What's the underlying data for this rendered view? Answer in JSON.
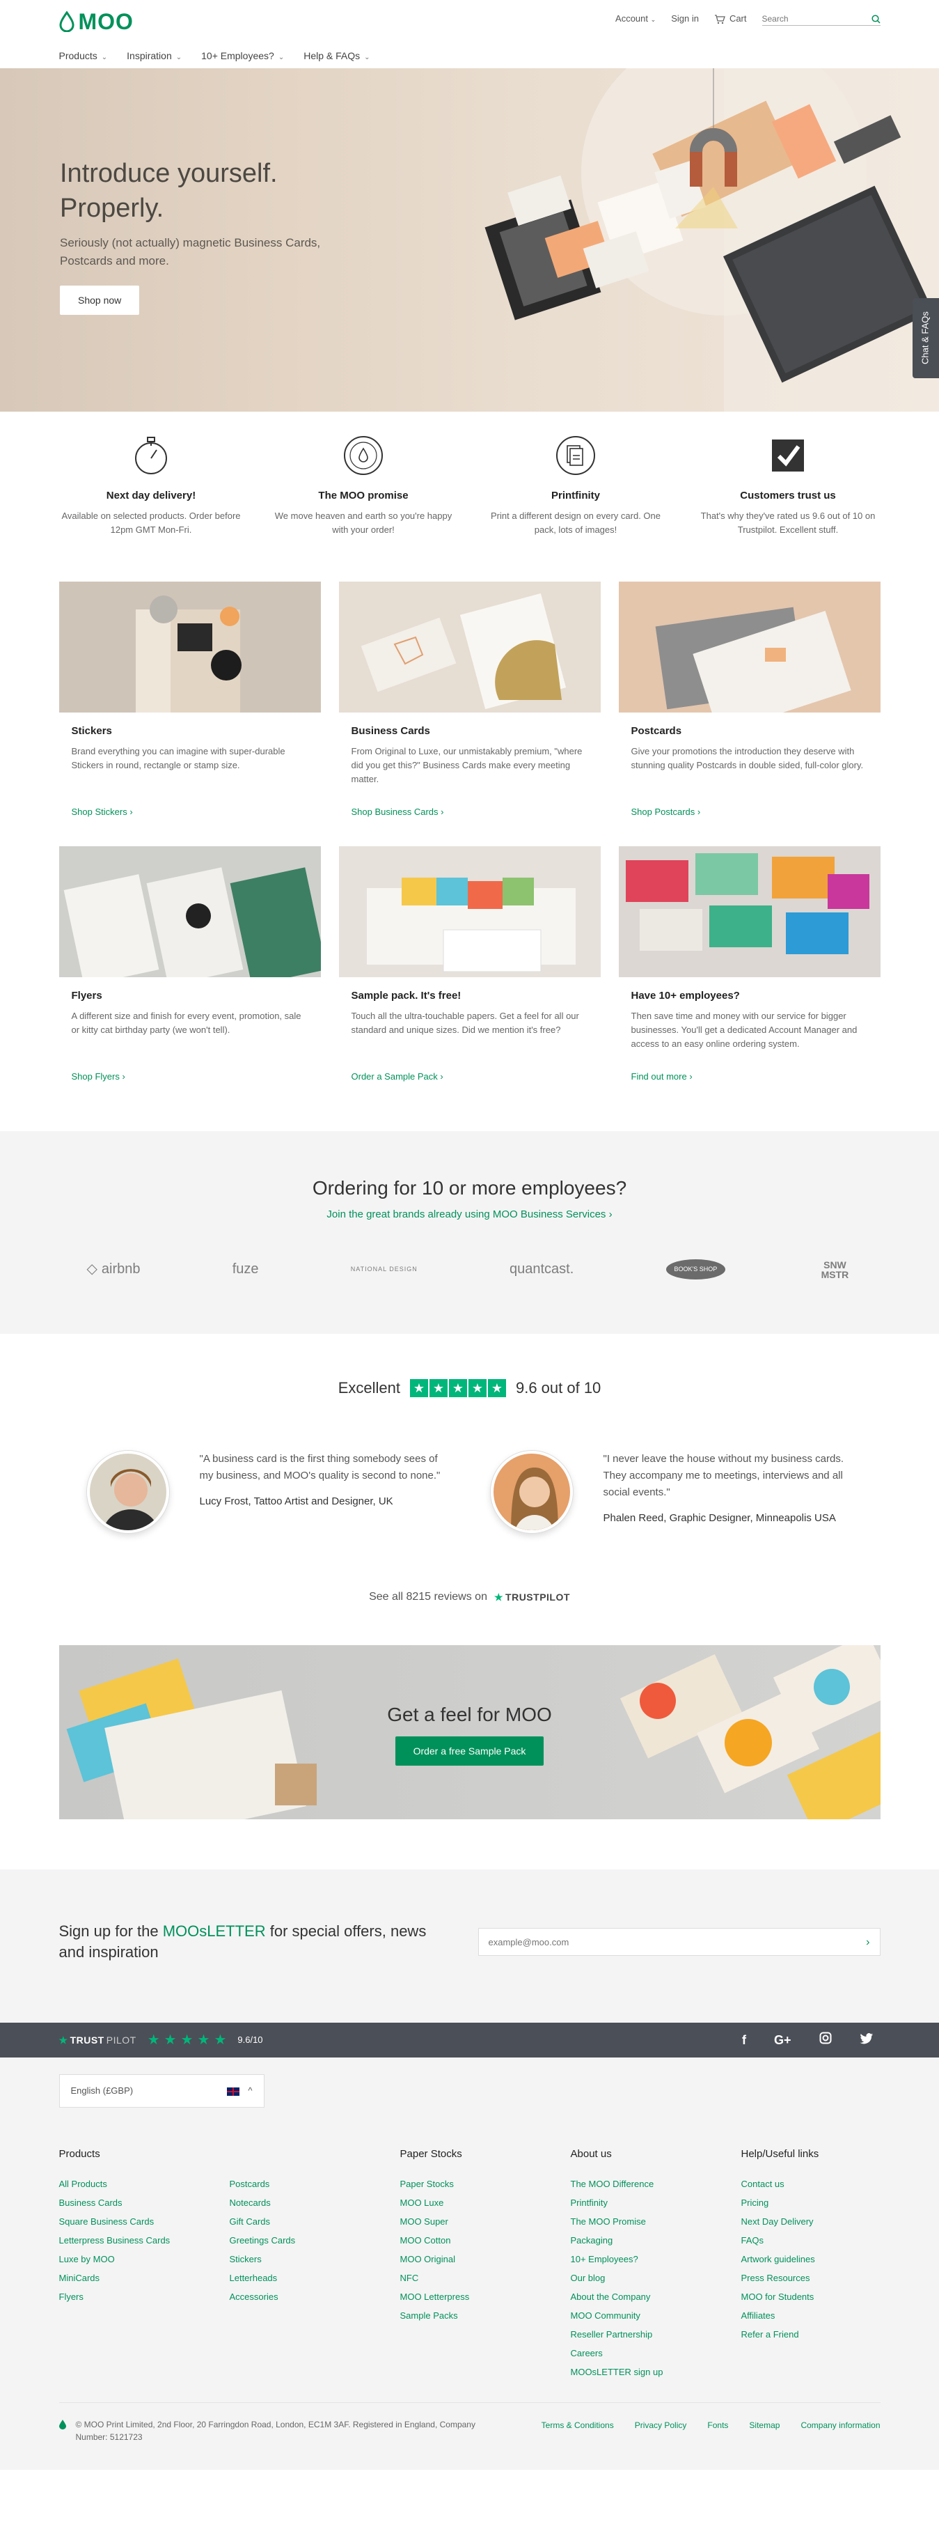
{
  "header": {
    "logo": "MOO",
    "account": "Account",
    "signin": "Sign in",
    "cart": "Cart",
    "search_placeholder": "Search"
  },
  "nav": [
    "Products",
    "Inspiration",
    "10+ Employees?",
    "Help & FAQs"
  ],
  "hero": {
    "title_line1": "Introduce yourself.",
    "title_line2": "Properly.",
    "subtitle": "Seriously (not actually) magnetic Business Cards, Postcards and more.",
    "cta": "Shop now",
    "chat_tab": "Chat & FAQs"
  },
  "features": [
    {
      "title": "Next day delivery!",
      "text": "Available on selected products. Order before 12pm GMT Mon-Fri.",
      "icon": "stopwatch-icon"
    },
    {
      "title": "The MOO promise",
      "text": "We move heaven and earth so you're happy with your order!",
      "icon": "moo-promise-seal-icon"
    },
    {
      "title": "Printfinity",
      "text": "Print a different design on every card. One pack, lots of images!",
      "icon": "printfinity-icon"
    },
    {
      "title": "Customers trust us",
      "text": "That's why they've rated us 9.6 out of 10 on Trustpilot. Excellent stuff.",
      "icon": "trust-check-icon"
    }
  ],
  "products": [
    {
      "title": "Stickers",
      "text": "Brand everything you can imagine with super-durable Stickers in round, rectangle or stamp size.",
      "link": "Shop Stickers",
      "bg": "#cfc4b8"
    },
    {
      "title": "Business Cards",
      "text": "From Original to Luxe, our unmistakably premium, \"where did you get this?\" Business Cards make every meeting matter.",
      "link": "Shop Business Cards",
      "bg": "#e6ddd3"
    },
    {
      "title": "Postcards",
      "text": "Give your promotions the introduction they deserve with stunning quality Postcards in double sided, full-color glory.",
      "link": "Shop Postcards",
      "bg": "#e4c6ad"
    },
    {
      "title": "Flyers",
      "text": "A different size and finish for every event, promotion, sale or kitty cat birthday party (we won't tell).",
      "link": "Shop Flyers",
      "bg": "#cfd0cc"
    },
    {
      "title": "Sample pack. It's free!",
      "text": "Touch all the ultra-touchable papers. Get a feel for all our standard and unique sizes. Did we mention it's free?",
      "link": "Order a Sample Pack",
      "bg": "#e6e1db"
    },
    {
      "title": "Have 10+ employees?",
      "text": "Then save time and money with our service for bigger businesses. You'll get a dedicated Account Manager and access to an easy online ordering system.",
      "link": "Find out more",
      "bg": "#dcd7d2"
    }
  ],
  "employees": {
    "title": "Ordering for 10 or more employees?",
    "subtitle": "Join the great brands already using MOO Business Services",
    "logos": [
      "airbnb",
      "fuze",
      "NATIONAL DESIGN",
      "quantcast.",
      "BOOK'S SHOP",
      "SNW MSTR"
    ]
  },
  "reviews": {
    "excellent": "Excellent",
    "score": "9.6 out of 10",
    "items": [
      {
        "quote": "\"A business card is the first thing somebody sees of my business, and MOO's quality is second to none.\"",
        "author": "Lucy Frost, Tattoo Artist and Designer, UK"
      },
      {
        "quote": "\"I never leave the house without my business cards. They accompany me to meetings, interviews and all social events.\"",
        "author": "Phalen Reed, Graphic Designer, Minneapolis USA"
      }
    ],
    "see_all": "See all 8215 reviews on",
    "trustpilot": "TRUSTPILOT"
  },
  "sample_banner": {
    "title": "Get a feel for MOO",
    "cta": "Order a free Sample Pack"
  },
  "newsletter": {
    "pre": "Sign up for the ",
    "brand": "MOOsLETTER",
    "post": " for special offers, news and inspiration",
    "placeholder": "example@moo.com"
  },
  "trustbar": {
    "brand": "TRUST",
    "brand2": "PILOT",
    "score": "9.6/10",
    "social": [
      "f",
      "G+",
      "ig",
      "tw"
    ]
  },
  "footer": {
    "language": "English (£GBP)",
    "columns": [
      {
        "title": "Products",
        "links": [
          "All Products",
          "Business Cards",
          "Square Business Cards",
          "Letterpress Business Cards",
          "Luxe by MOO",
          "MiniCards",
          "Flyers"
        ]
      },
      {
        "title": "",
        "links": [
          "Postcards",
          "Notecards",
          "Gift Cards",
          "Greetings Cards",
          "Stickers",
          "Letterheads",
          "Accessories"
        ]
      },
      {
        "title": "Paper Stocks",
        "links": [
          "Paper Stocks",
          "MOO Luxe",
          "MOO Super",
          "MOO Cotton",
          "MOO Original",
          "NFC",
          "MOO Letterpress",
          "Sample Packs"
        ]
      },
      {
        "title": "About us",
        "links": [
          "The MOO Difference",
          "Printfinity",
          "The MOO Promise",
          "Packaging",
          "10+ Employees?",
          "Our blog",
          "About the Company",
          "MOO Community",
          "Reseller Partnership",
          "Careers",
          "MOOsLETTER sign up"
        ]
      },
      {
        "title": "Help/Useful links",
        "links": [
          "Contact us",
          "Pricing",
          "Next Day Delivery",
          "FAQs",
          "Artwork guidelines",
          "Press Resources",
          "MOO for Students",
          "Affiliates",
          "Refer a Friend"
        ]
      }
    ],
    "copyright": "© MOO Print Limited, 2nd Floor, 20 Farringdon Road, London, EC1M 3AF. Registered in England, Company Number: 5121723",
    "legal_links": [
      "Terms & Conditions",
      "Privacy Policy",
      "Fonts",
      "Sitemap",
      "Company information"
    ]
  }
}
